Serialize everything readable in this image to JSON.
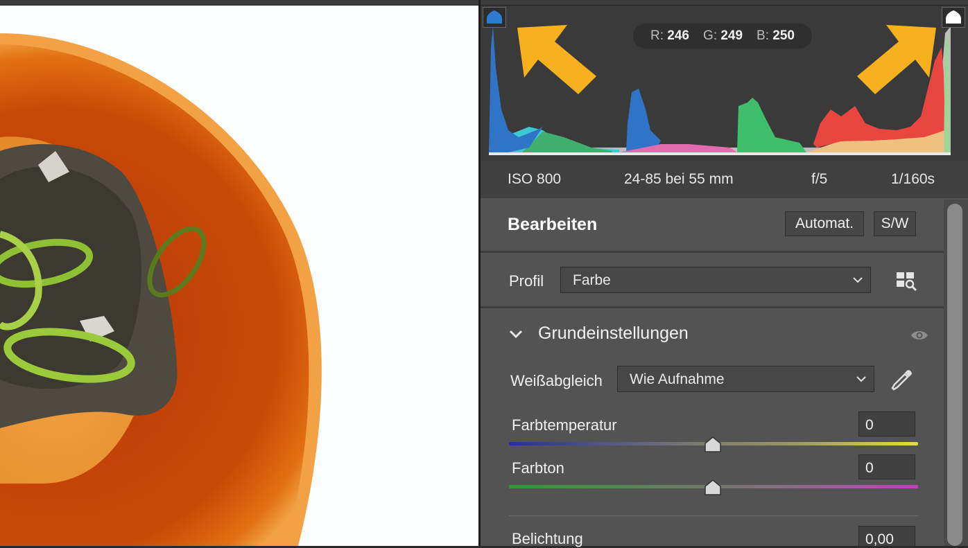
{
  "histogram": {
    "readout": {
      "r_label": "R:",
      "r_value": "246",
      "g_label": "G:",
      "g_value": "249",
      "b_label": "B:",
      "b_value": "250"
    },
    "shadow_clip_icon": "shadow-clipping-warning",
    "highlight_clip_icon": "highlight-clipping-warning",
    "annotation_color": "#f7b11e"
  },
  "exif": {
    "iso": "ISO 800",
    "lens": "24-85 bei 55 mm",
    "aperture": "f/5",
    "shutter": "1/160s"
  },
  "edit": {
    "title": "Bearbeiten",
    "auto_label": "Automat.",
    "bw_label": "S/W",
    "profile_label": "Profil",
    "profile_value": "Farbe",
    "profile_browser_icon": "grid-search-icon"
  },
  "basic": {
    "title": "Grundeinstellungen",
    "wb_label": "Weißabgleich",
    "wb_value": "Wie Aufnahme",
    "eyedropper_icon": "eyedropper-icon",
    "temp_label": "Farbtemperatur",
    "temp_value": "0",
    "tint_label": "Farbton",
    "tint_value": "0",
    "exposure_label": "Belichtung",
    "exposure_value": "0,00"
  }
}
